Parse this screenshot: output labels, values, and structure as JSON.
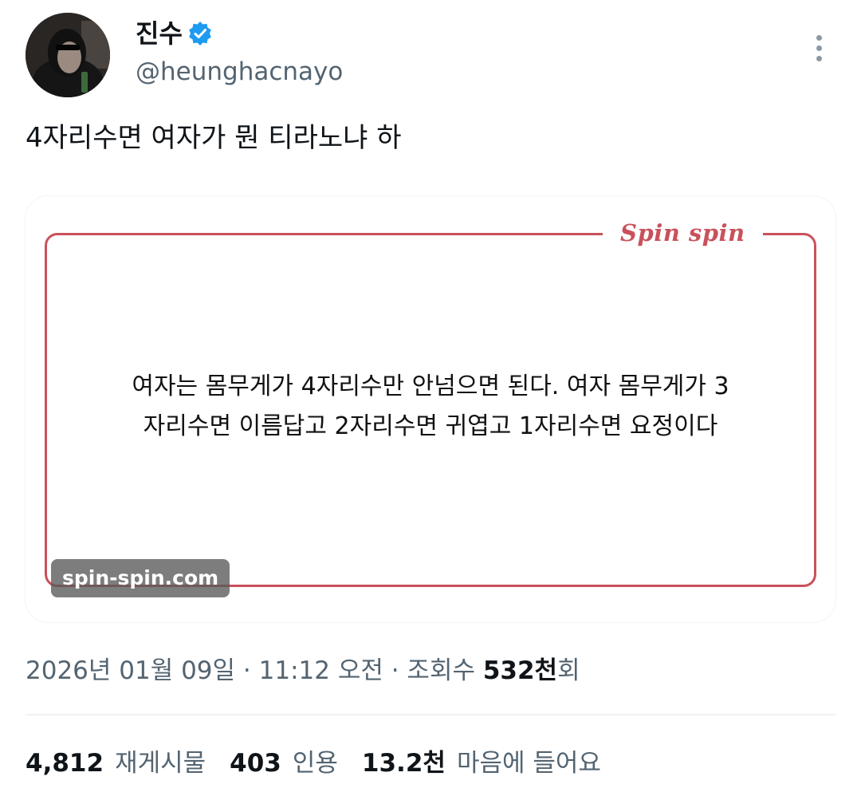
{
  "author": {
    "display_name": "진수",
    "handle": "@heunghacnayo",
    "avatar_icon": "avatar-masked-person",
    "verified_icon": "verified-badge-icon"
  },
  "tweet": {
    "text": "4자리수면 여자가 뭔 티라노냐 하"
  },
  "media": {
    "brand": "Spin spin",
    "quote_line_1": "여자는 몸무게가 4자리수만 안넘으면 된다. 여자 몸무게가 3",
    "quote_line_2": "자리수면 이름답고 2자리수면 귀엽고 1자리수면 요정이다",
    "watermark": "spin-spin.com"
  },
  "meta": {
    "date": "2026년 01월 09일",
    "sep1": " · ",
    "time": "11:12 오전",
    "sep2": " · ",
    "views_label": "조회수 ",
    "views_value": "532천",
    "views_suffix": "회"
  },
  "stats": {
    "reposts_value": "4,812",
    "reposts_label": "재게시물",
    "quotes_value": "403",
    "quotes_label": "인용",
    "likes_value": "13.2천",
    "likes_label": "마음에 들어요"
  },
  "colors": {
    "brand_red": "#c9515b",
    "verified_blue": "#1d9bf0",
    "secondary_text": "#536471"
  }
}
